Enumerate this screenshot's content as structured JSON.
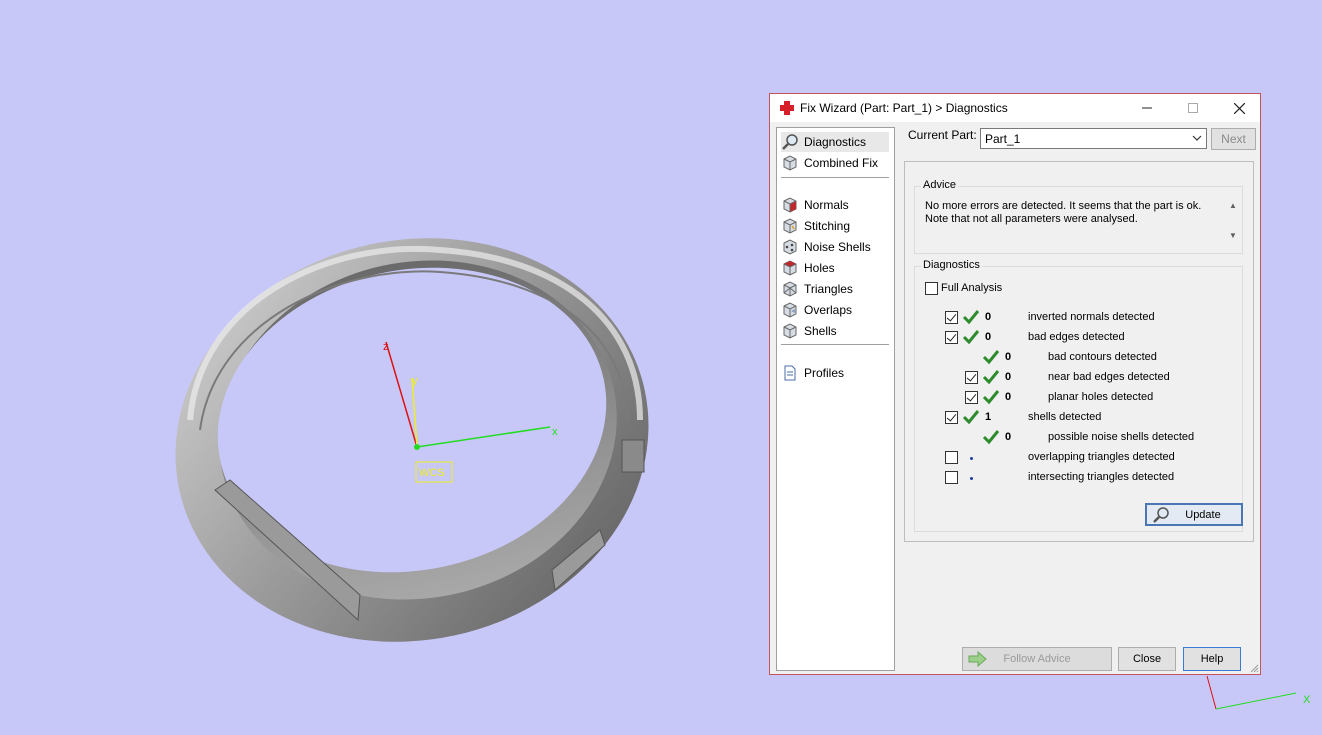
{
  "viewport": {
    "axis_x_label": "x",
    "axis_y_label": "y",
    "axis_z_label": "z",
    "wcs_label": "WCS",
    "corner_axis_x_label": "X"
  },
  "dialog": {
    "title": "Fix Wizard (Part: Part_1) > Diagnostics",
    "nav": [
      {
        "label": "Diagnostics",
        "icon": "magnifier-icon"
      },
      {
        "label": "Combined Fix",
        "icon": "cube-icon"
      },
      {
        "label": "Normals",
        "icon": "normals-cube-icon"
      },
      {
        "label": "Stitching",
        "icon": "stitching-cube-icon"
      },
      {
        "label": "Noise Shells",
        "icon": "noise-shells-icon"
      },
      {
        "label": "Holes",
        "icon": "holes-cube-icon"
      },
      {
        "label": "Triangles",
        "icon": "triangles-cube-icon"
      },
      {
        "label": "Overlaps",
        "icon": "overlaps-cube-icon"
      },
      {
        "label": "Shells",
        "icon": "shells-cube-icon"
      },
      {
        "label": "Profiles",
        "icon": "document-icon"
      }
    ],
    "current_part_label": "Current Part:",
    "current_part_value": "Part_1",
    "next_label": "Next",
    "advice_label": "Advice",
    "advice_text": "No more errors are detected. It seems that the part is ok.\nNote that not all parameters were analysed.",
    "diagnostics_label": "Diagnostics",
    "full_analysis_label": "Full Analysis",
    "full_analysis_checked": false,
    "rows": [
      {
        "checkbox": true,
        "checked": true,
        "status": "ok",
        "count": "0",
        "text": "inverted normals detected"
      },
      {
        "checkbox": true,
        "checked": true,
        "status": "ok",
        "count": "0",
        "text": "bad edges detected"
      },
      {
        "checkbox": false,
        "checked": false,
        "status": "ok",
        "count": "0",
        "text": "bad contours detected"
      },
      {
        "checkbox": true,
        "checked": true,
        "status": "ok",
        "count": "0",
        "text": "near bad edges detected"
      },
      {
        "checkbox": true,
        "checked": true,
        "status": "ok",
        "count": "0",
        "text": "planar holes detected"
      },
      {
        "checkbox": true,
        "checked": true,
        "status": "ok",
        "count": "1",
        "text": "shells detected"
      },
      {
        "checkbox": false,
        "checked": false,
        "status": "ok",
        "count": "0",
        "text": "possible noise shells detected"
      },
      {
        "checkbox": true,
        "checked": false,
        "status": "pending",
        "count": "",
        "text": "overlapping triangles detected"
      },
      {
        "checkbox": true,
        "checked": false,
        "status": "pending",
        "count": "",
        "text": "intersecting triangles detected"
      }
    ],
    "update_label": "Update",
    "follow_advice_label": "Follow Advice",
    "close_label": "Close",
    "help_label": "Help",
    "colors": {
      "accent": "#3a7bd5",
      "ok_green": "#2e8b2e",
      "frame": "#c3535d",
      "background": "#c8c8f8"
    }
  }
}
